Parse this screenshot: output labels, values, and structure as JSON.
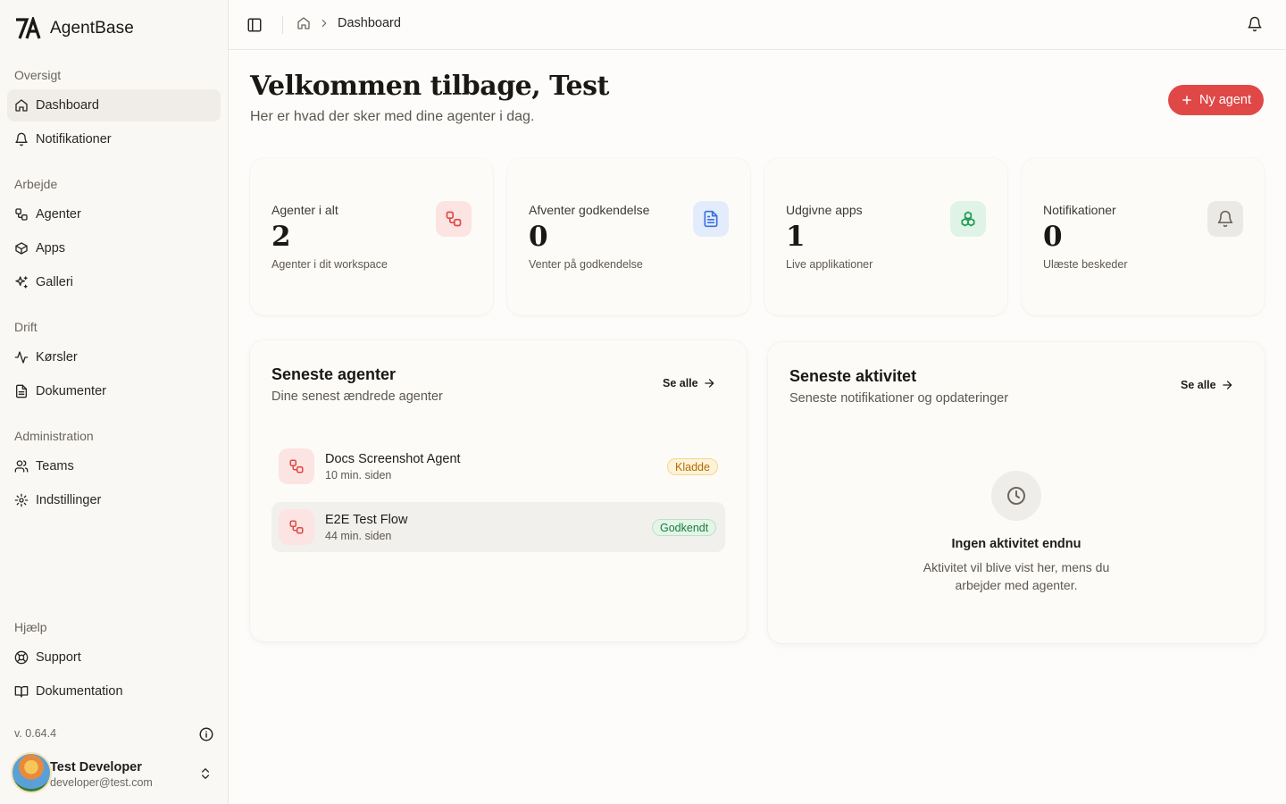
{
  "brand": {
    "name": "AgentBase",
    "logo_text": "7A"
  },
  "sidebar": {
    "sections": [
      {
        "label": "Oversigt"
      },
      {
        "label": "Arbejde"
      },
      {
        "label": "Drift"
      },
      {
        "label": "Administration"
      },
      {
        "label": "Hjælp"
      }
    ],
    "items": [
      {
        "label": "Dashboard",
        "icon": "home-icon",
        "active": true
      },
      {
        "label": "Notifikationer",
        "icon": "bell-icon"
      },
      {
        "label": "Agenter",
        "icon": "workflow-icon"
      },
      {
        "label": "Apps",
        "icon": "box-icon"
      },
      {
        "label": "Galleri",
        "icon": "sparkles-icon"
      },
      {
        "label": "Kørsler",
        "icon": "activity-icon"
      },
      {
        "label": "Dokumenter",
        "icon": "file-icon"
      },
      {
        "label": "Teams",
        "icon": "users-icon"
      },
      {
        "label": "Indstillinger",
        "icon": "gear-icon"
      },
      {
        "label": "Support",
        "icon": "lifebuoy-icon"
      },
      {
        "label": "Dokumentation",
        "icon": "book-icon"
      }
    ],
    "version": "v. 0.64.4",
    "user": {
      "name": "Test Developer",
      "email": "developer@test.com"
    }
  },
  "topbar": {
    "breadcrumb_current": "Dashboard"
  },
  "main": {
    "title": "Velkommen tilbage, Test",
    "subtitle": "Her er hvad der sker med dine agenter i dag.",
    "new_agent_label": "Ny agent",
    "stats": [
      {
        "label": "Agenter i alt",
        "value": "2",
        "desc": "Agenter i dit workspace",
        "icon": "workflow-icon",
        "color": "#e04848",
        "bg": "#fbe4e1"
      },
      {
        "label": "Afventer godkendelse",
        "value": "0",
        "desc": "Venter på godkendelse",
        "icon": "file-text-icon",
        "color": "#3b6fe0",
        "bg": "#e3ecfb"
      },
      {
        "label": "Udgivne apps",
        "value": "1",
        "desc": "Live applikationer",
        "icon": "boxes-icon",
        "color": "#1f9a55",
        "bg": "#dff3e6"
      },
      {
        "label": "Notifikationer",
        "value": "0",
        "desc": "Ulæste beskeder",
        "icon": "bell-icon",
        "color": "#6b665f",
        "bg": "#ebe9e5"
      }
    ],
    "recent_agents": {
      "title": "Seneste agenter",
      "subtitle": "Dine senest ændrede agenter",
      "see_all": "Se alle",
      "rows": [
        {
          "name": "Docs Screenshot Agent",
          "time": "10 min. siden",
          "status": "Kladde"
        },
        {
          "name": "E2E Test Flow",
          "time": "44 min. siden",
          "status": "Godkendt"
        }
      ]
    },
    "recent_activity": {
      "title": "Seneste aktivitet",
      "subtitle": "Seneste notifikationer og opdateringer",
      "see_all": "Se alle",
      "empty_title": "Ingen aktivitet endnu",
      "empty_desc": "Aktivitet vil blive vist her, mens du arbejder med agenter."
    }
  }
}
